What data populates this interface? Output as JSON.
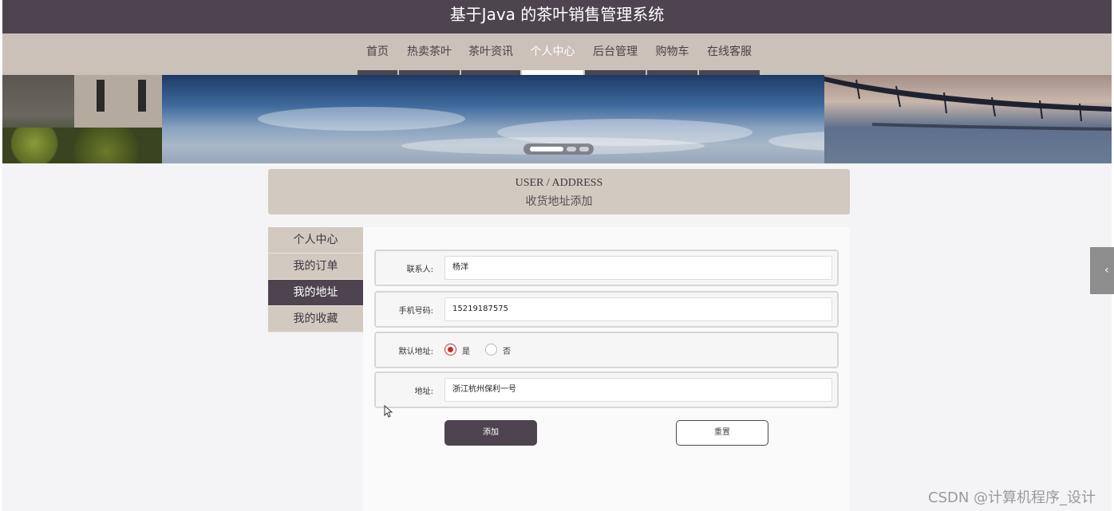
{
  "header": {
    "title": "基于Java 的茶叶销售管理系统"
  },
  "nav": {
    "items": [
      {
        "label": "首页",
        "active": false
      },
      {
        "label": "热卖茶叶",
        "active": false
      },
      {
        "label": "茶叶资讯",
        "active": false
      },
      {
        "label": "个人中心",
        "active": true
      },
      {
        "label": "后台管理",
        "active": false
      },
      {
        "label": "购物车",
        "active": false
      },
      {
        "label": "在线客服",
        "active": false
      }
    ]
  },
  "banner": {
    "slides": 3,
    "active_slide": 1
  },
  "section": {
    "title_en": "USER / ADDRESS",
    "title_cn": "收货地址添加"
  },
  "sidebar": {
    "items": [
      {
        "label": "个人中心",
        "active": false
      },
      {
        "label": "我的订单",
        "active": false
      },
      {
        "label": "我的地址",
        "active": true
      },
      {
        "label": "我的收藏",
        "active": false
      }
    ]
  },
  "form": {
    "contact": {
      "label": "联系人:",
      "value": "杨洋"
    },
    "phone": {
      "label": "手机号码:",
      "value": "15219187575"
    },
    "default_address": {
      "label": "默认地址:",
      "options": [
        {
          "label": "是",
          "checked": true
        },
        {
          "label": "否",
          "checked": false
        }
      ]
    },
    "address": {
      "label": "地址:",
      "value": "浙江杭州保利一号"
    }
  },
  "buttons": {
    "add": "添加",
    "reset": "重置"
  },
  "watermark": "CSDN @计算机程序_设计",
  "colors": {
    "primary": "#4e4450",
    "nav_bg": "#cbc1b9",
    "radio_checked": "#c0302f"
  }
}
